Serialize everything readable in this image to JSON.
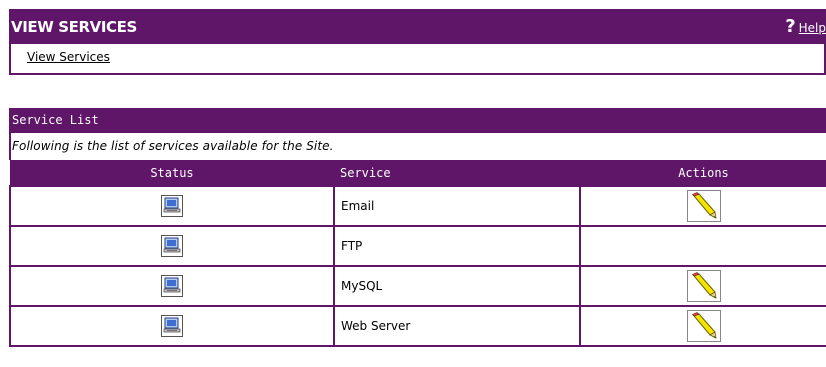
{
  "header": {
    "title": "VIEW SERVICES",
    "help_icon": "?",
    "help_label": "Help"
  },
  "breadcrumb": {
    "label": "View Services"
  },
  "service_list": {
    "title": "Service List",
    "description": "Following is the list of services available for the Site.",
    "columns": {
      "status": "Status",
      "service": "Service",
      "actions": "Actions"
    },
    "rows": [
      {
        "service": "Email",
        "status_icon": "monitor-icon",
        "has_edit": true
      },
      {
        "service": "FTP",
        "status_icon": "monitor-icon",
        "has_edit": false
      },
      {
        "service": "MySQL",
        "status_icon": "monitor-icon",
        "has_edit": true
      },
      {
        "service": "Web Server",
        "status_icon": "monitor-icon",
        "has_edit": true
      }
    ]
  },
  "colors": {
    "brand": "#5f1668",
    "text": "#000000",
    "header_text": "#ffffff"
  }
}
